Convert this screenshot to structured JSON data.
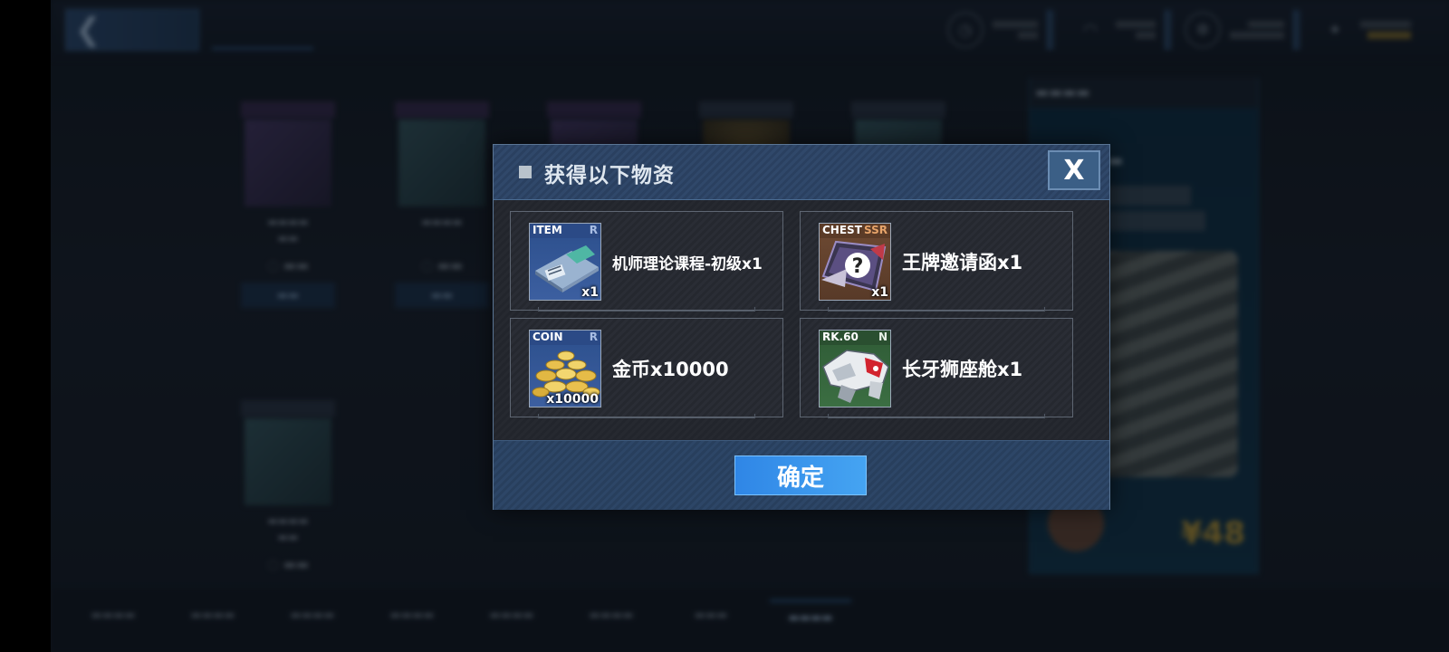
{
  "dialog": {
    "title": "获得以下物资",
    "close_label": "X",
    "confirm_label": "确定",
    "rewards": [
      {
        "category": "ITEM",
        "rarity": "R",
        "count": "x1",
        "name": "机师理论课程-初级x1",
        "icon": "course-disc-icon"
      },
      {
        "category": "CHEST",
        "rarity": "SSR",
        "count": "x1",
        "name": "王牌邀请函x1",
        "icon": "mystery-chest-icon"
      },
      {
        "category": "COIN",
        "rarity": "R",
        "count": "x10000",
        "name": "金币x10000",
        "icon": "gold-coins-icon"
      },
      {
        "category": "RK.60",
        "rarity": "N",
        "count": "",
        "name": "长牙狮座舱x1",
        "icon": "lion-cockpit-icon"
      }
    ]
  },
  "colors": {
    "header_bg": "#2d4566",
    "confirm_bg": "#3a95ec",
    "rarity_ssr": "#e7a46a",
    "rarity_r": "#a9bee4"
  }
}
